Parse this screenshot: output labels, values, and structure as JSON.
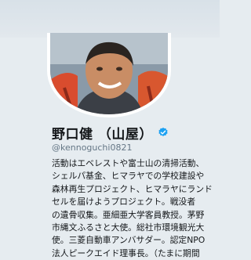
{
  "profile": {
    "display_name": "野口健 （山屋）",
    "handle": "@kennoguchi0821",
    "verified_icon": "verified-badge-icon",
    "verified_color": "#1da1f2",
    "bio_lines": [
      "活動はエベレストや富士山の清掃活動、",
      "シェルパ基金、ヒマラヤでの学校建設や",
      "森林再生プロジェクト、ヒマラヤにランド",
      "セルを届けようプロジェクト。戦没者",
      "の遺骨収集。亜細亜大学客員教授。茅野",
      "市縄文ふるさと大使。総社市環境観光大",
      "使。三菱自動車アンバサダー。認定NPO",
      "法人ピークエイド理事長。（たまに期間"
    ]
  },
  "colors": {
    "background": "#e6ecf0",
    "text": "#14171a",
    "secondary_text": "#657786",
    "avatar_border": "#ffffff"
  }
}
